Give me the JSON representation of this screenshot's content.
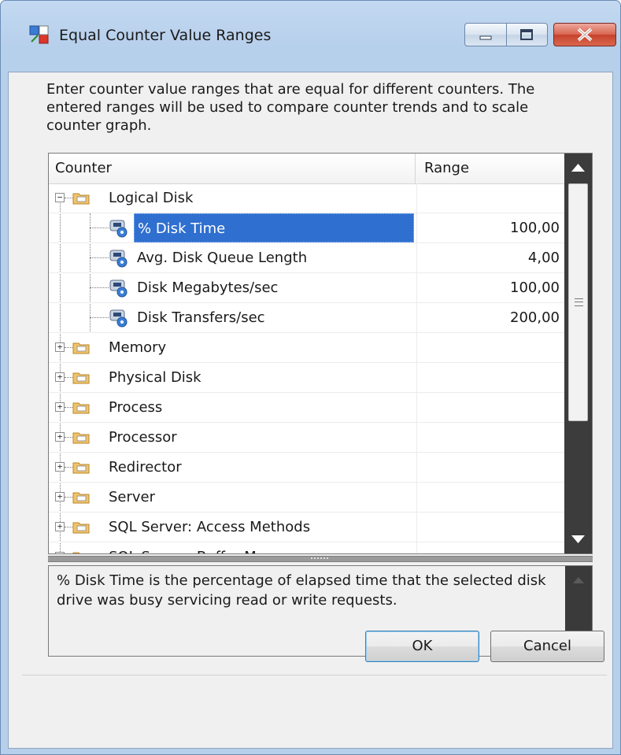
{
  "window": {
    "title": "Equal Counter Value Ranges"
  },
  "description": "Enter counter value ranges that are equal for different counters. The entered ranges will be used to compare counter trends and to scale counter graph.",
  "tree": {
    "columns": {
      "counter": "Counter",
      "range": "Range"
    },
    "rows": [
      {
        "label": "Logical Disk",
        "range": ""
      },
      {
        "label": "% Disk Time",
        "range": "100,00"
      },
      {
        "label": "Avg. Disk Queue Length",
        "range": "4,00"
      },
      {
        "label": "Disk Megabytes/sec",
        "range": "100,00"
      },
      {
        "label": "Disk Transfers/sec",
        "range": "200,00"
      },
      {
        "label": "Memory",
        "range": ""
      },
      {
        "label": "Physical Disk",
        "range": ""
      },
      {
        "label": "Process",
        "range": ""
      },
      {
        "label": "Processor",
        "range": ""
      },
      {
        "label": "Redirector",
        "range": ""
      },
      {
        "label": "Server",
        "range": ""
      },
      {
        "label": "SQL Server: Access Methods",
        "range": ""
      },
      {
        "label": "SQL Server: Buffer Manager",
        "range": ""
      }
    ],
    "selected": "% Disk Time"
  },
  "help_text": "% Disk Time is the percentage of elapsed time that the selected disk drive was busy servicing read or write requests.",
  "buttons": {
    "ok": "OK",
    "cancel": "Cancel"
  },
  "colors": {
    "selection": "#2f6fcf",
    "titlebar": "#c3d9f1",
    "close": "#c6422b"
  }
}
